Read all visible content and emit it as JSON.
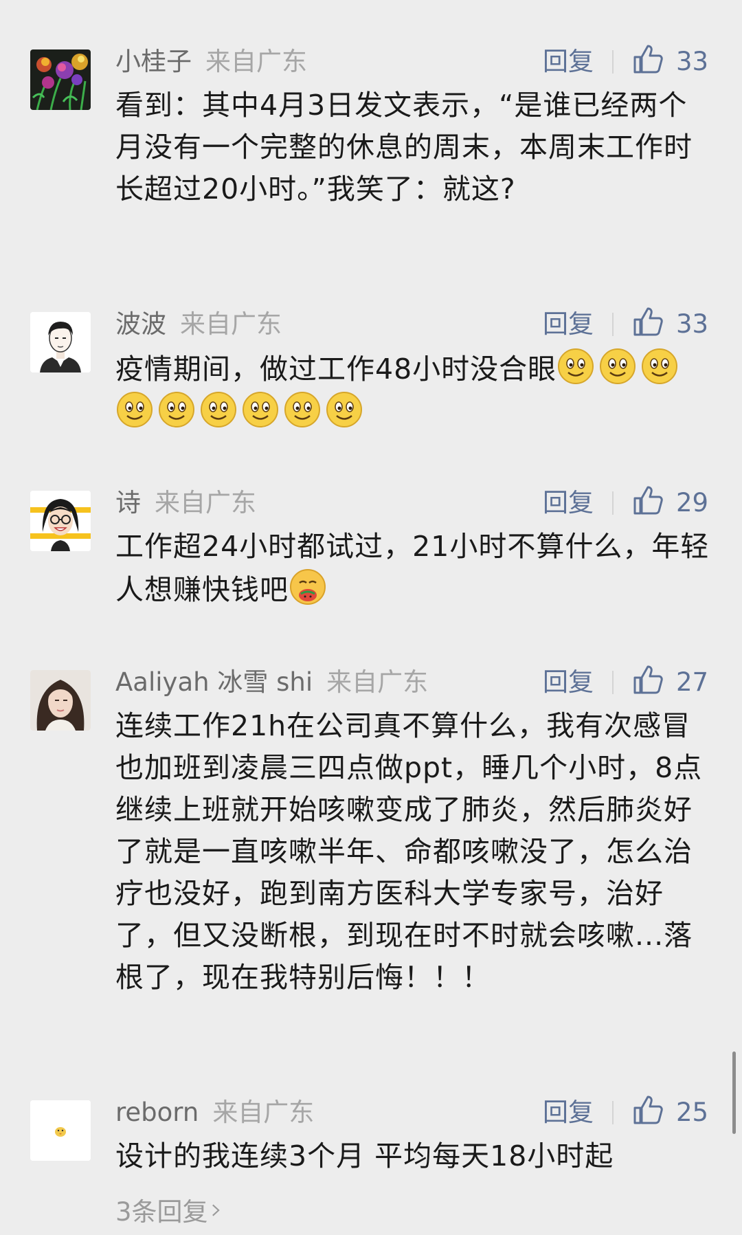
{
  "comments": [
    {
      "name": "小桂子",
      "region": "来自广东",
      "reply_label": "回复",
      "likes": "33",
      "text": "看到：其中4月3日发文表示，“是谁已经两个月没有一个完整的休息的周末，本周末工作时长超过20小时。”我笑了：就这?"
    },
    {
      "name": "波波",
      "region": "来自广东",
      "reply_label": "回复",
      "likes": "33",
      "text": "疫情期间，做过工作48小时没合眼",
      "emoji_count": 9,
      "emoji": "smile-emoji"
    },
    {
      "name": "诗",
      "region": "来自广东",
      "reply_label": "回复",
      "likes": "29",
      "text": "工作超24小时都试过，21小时不算什么，年轻人想赚快钱吧",
      "emoji": "money-mouth-emoji"
    },
    {
      "name": "Aaliyah 冰雪 shi",
      "region": "来自广东",
      "reply_label": "回复",
      "likes": "27",
      "text": "连续工作21h在公司真不算什么，我有次感冒也加班到凌晨三四点做ppt，睡几个小时，8点继续上班就开始咳嗽变成了肺炎，然后肺炎好了就是一直咳嗽半年、命都咳嗽没了，怎么治疗也没好，跑到南方医科大学专家号，治好了，但又没断根，到现在时不时就会咳嗽...落根了，现在我特别后悔！！！"
    },
    {
      "name": "reborn",
      "region": "来自广东",
      "reply_label": "回复",
      "likes": "25",
      "text": "设计的我连续3个月 平均每天18小时起",
      "more_replies": "3条回复"
    }
  ],
  "colors": {
    "background": "#ededed",
    "name": "#6b6b6b",
    "region": "#a6a6a6",
    "action": "#5d7196",
    "text": "#1a1a1a"
  }
}
